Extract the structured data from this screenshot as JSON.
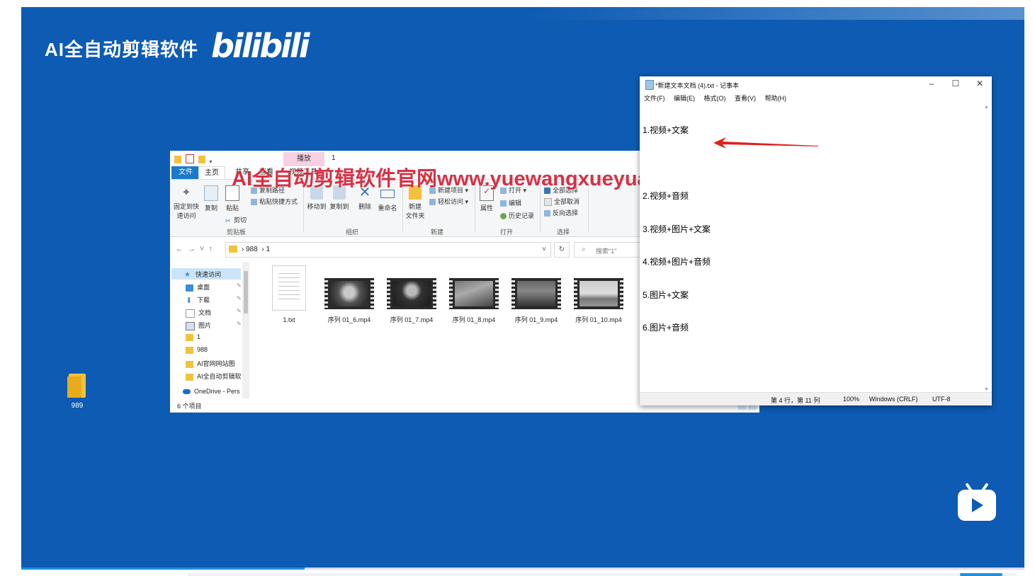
{
  "banner": {
    "title": "AI全自动剪辑软件",
    "logo_text": "bilibili"
  },
  "desktop": {
    "folder_label": "989"
  },
  "explorer": {
    "manage_tab": "播放",
    "folder_title": "1",
    "tabs": [
      "文件",
      "主页",
      "共享",
      "查看",
      "视频工具"
    ],
    "ribbon": {
      "pin_label_line1": "固定到快",
      "pin_label_line2": "速访问",
      "copy_label": "复制",
      "paste_label": "粘贴",
      "copy_path": "复制路径",
      "paste_shortcut": "粘贴快捷方式",
      "cut": "剪切",
      "move_to": "移动到",
      "copy_to": "复制到",
      "delete": "删除",
      "rename": "重命名",
      "new_folder_line1": "新建",
      "new_folder_line2": "文件夹",
      "new_item": "新建项目",
      "easy_access": "轻松访问",
      "properties": "属性",
      "open": "打开",
      "edit": "编辑",
      "history": "历史记录",
      "select_all": "全部选择",
      "select_none": "全部取消",
      "invert_selection": "反向选择",
      "groups": [
        "剪贴板",
        "组织",
        "新建",
        "打开",
        "选择"
      ]
    },
    "address": {
      "crumb1": "988",
      "crumb2": "1",
      "search_placeholder": "搜索\"1\""
    },
    "nav": {
      "quick_access": "快速访问",
      "items": [
        "桌面",
        "下载",
        "文档",
        "图片",
        "1",
        "988",
        "AI官网网站图",
        "AI全自动剪辑软"
      ],
      "onedrive": "OneDrive - Pers"
    },
    "files": [
      "1.txt",
      "序列 01_6.mp4",
      "序列 01_7.mp4",
      "序列 01_8.mp4",
      "序列 01_9.mp4",
      "序列 01_10.mp4"
    ],
    "status": "6 个项目"
  },
  "watermark": "AI全自动剪辑软件官网www.yuewangxueyuan.com",
  "notepad": {
    "title": "*新建文本文档 (4).txt - 记事本",
    "menu": [
      "文件(F)",
      "编辑(E)",
      "格式(O)",
      "查看(V)",
      "帮助(H)"
    ],
    "lines": [
      "1.视频+文案",
      "",
      "2.视频+音频",
      "3.视频+图片+文案",
      "4.视频+图片+音频",
      "5.图片+文案",
      "6.图片+音频"
    ],
    "status": {
      "position": "第 4 行，第 11 列",
      "zoom": "100%",
      "eol": "Windows (CRLF)",
      "encoding": "UTF-8"
    }
  },
  "colors": {
    "background_blue": "#0d5bb3",
    "annotation_red": "#e02020",
    "watermark_red": "#d5263c"
  }
}
